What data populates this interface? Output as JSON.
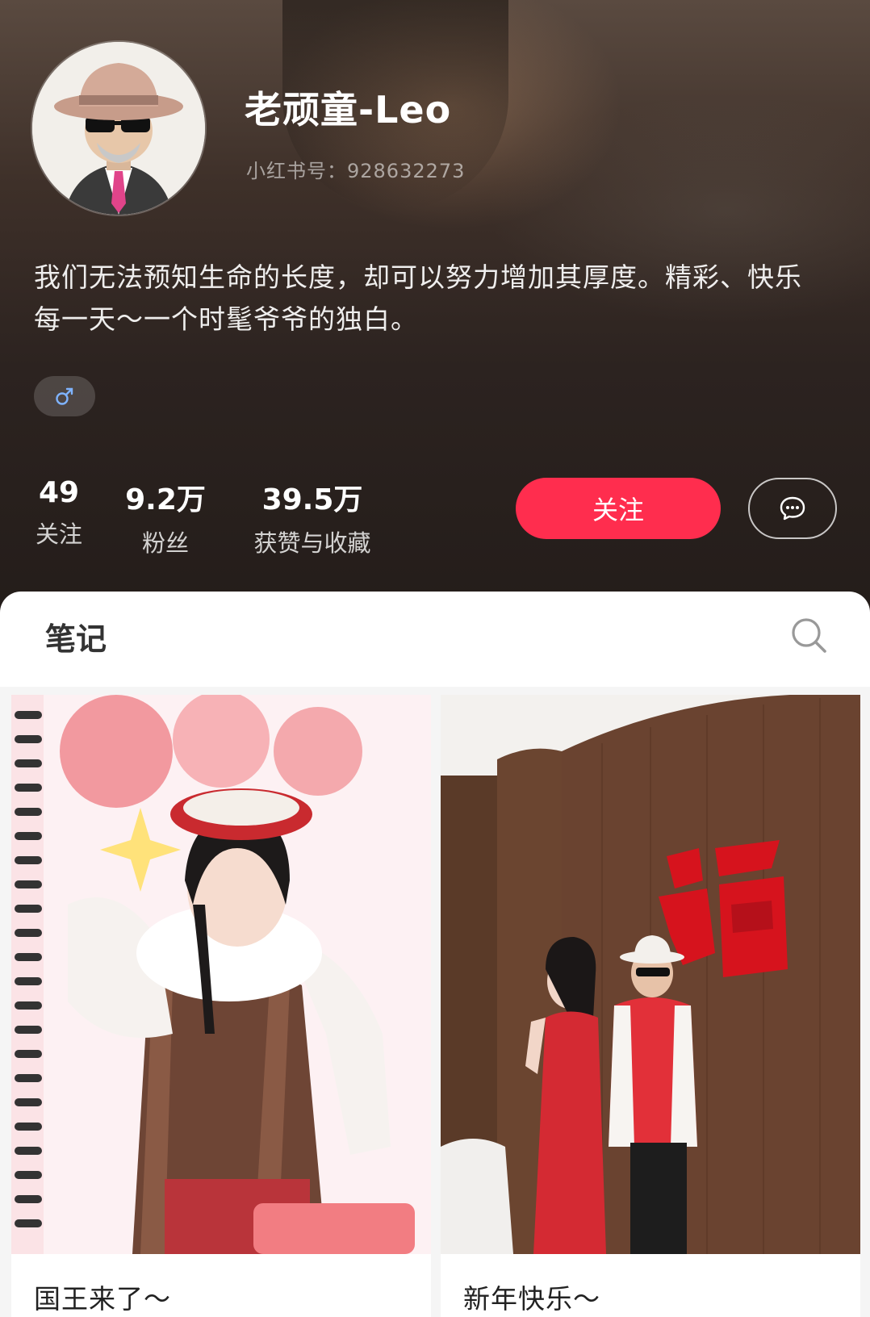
{
  "profile": {
    "username": "老顽童-Leo",
    "red_id": "小红书号：928632273",
    "bio": "我们无法预知生命的长度，却可以努力增加其厚度。精彩、快乐每一天～一个时髦爷爷的独白。",
    "gender_icon": "male-icon",
    "stats": [
      {
        "value": "49",
        "label": "关注"
      },
      {
        "value": "9.2万",
        "label": "粉丝"
      },
      {
        "value": "39.5万",
        "label": "获赞与收藏"
      }
    ],
    "follow_label": "关注",
    "message_icon": "chat-bubble-icon"
  },
  "tabs": {
    "notes_label": "笔记",
    "search_icon": "search-icon"
  },
  "notes": [
    {
      "title": "国王来了～"
    },
    {
      "title": "新年快乐～"
    }
  ],
  "colors": {
    "accent": "#ff2d4e",
    "header_bg": "#2c2320"
  }
}
